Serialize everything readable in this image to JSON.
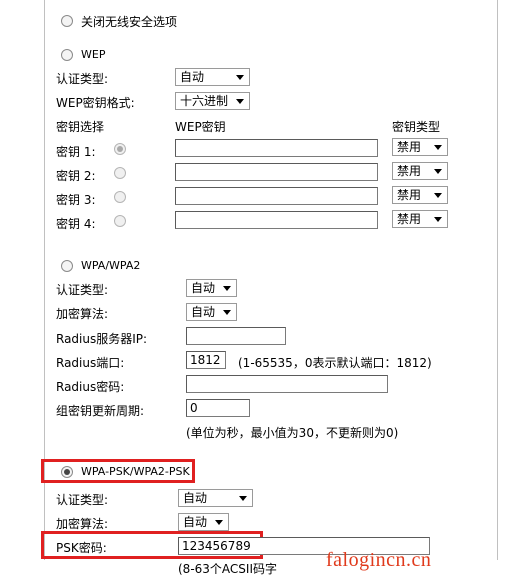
{
  "options": {
    "disable": "关闭无线安全选项",
    "wep": "WEP",
    "wpa": "WPA/WPA2",
    "wpa_psk": "WPA-PSK/WPA2-PSK"
  },
  "wep": {
    "auth_label": "认证类型:",
    "auth_value": "自动",
    "format_label": "WEP密钥格式:",
    "format_value": "十六进制",
    "col_select": "密钥选择",
    "col_key": "WEP密钥",
    "col_type": "密钥类型",
    "keys": [
      {
        "label": "密钥 1:",
        "type": "禁用"
      },
      {
        "label": "密钥 2:",
        "type": "禁用"
      },
      {
        "label": "密钥 3:",
        "type": "禁用"
      },
      {
        "label": "密钥 4:",
        "type": "禁用"
      }
    ]
  },
  "wpa": {
    "auth_label": "认证类型:",
    "auth_value": "自动",
    "enc_label": "加密算法:",
    "enc_value": "自动",
    "radius_ip_label": "Radius服务器IP:",
    "radius_port_label": "Radius端口:",
    "radius_port_value": "1812",
    "radius_port_hint": "(1-65535，0表示默认端口：1812)",
    "radius_pwd_label": "Radius密码:",
    "rekey_label": "组密钥更新周期:",
    "rekey_value": "0",
    "rekey_hint": "(单位为秒，最小值为30，不更新则为0)"
  },
  "psk": {
    "auth_label": "认证类型:",
    "auth_value": "自动",
    "enc_label": "加密算法:",
    "enc_value": "自动",
    "pwd_label": "PSK密码:",
    "pwd_value": "123456789",
    "pwd_hint": "(8-63个ACSII码字"
  },
  "watermark": "falogincn.cn",
  "colors": {
    "highlight": "#e02020",
    "watermark": "#e03a1c"
  }
}
